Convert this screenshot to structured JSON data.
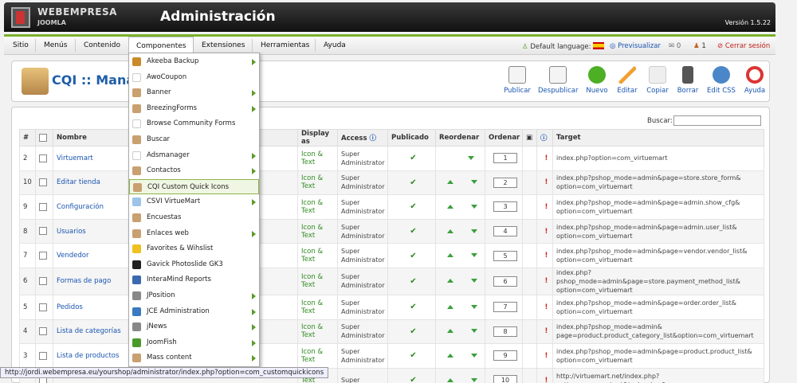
{
  "header": {
    "logo": "WEBEMPRESA",
    "logo_sub": "JOOMLA",
    "title": "Administración",
    "version": "Versión 1.5.22"
  },
  "menu": [
    "Sitio",
    "Menús",
    "Contenido",
    "Componentes",
    "Extensiones",
    "Herramientas",
    "Ayuda"
  ],
  "status": {
    "default_language": "Default language:",
    "preview": "Previsualizar",
    "messages": "0",
    "users": "1",
    "logout": "Cerrar sesión"
  },
  "page_title": "CQI :: Manag",
  "toolbar": [
    "Publicar",
    "Despublicar",
    "Nuevo",
    "Editar",
    "Copiar",
    "Borrar",
    "Edit CSS",
    "Ayuda"
  ],
  "search_label": "Buscar:",
  "columns": [
    "#",
    "",
    "Nombre",
    "Display as",
    "Access",
    "Publicado",
    "Reordenar",
    "Ordenar",
    "",
    "",
    "Target"
  ],
  "rows": [
    {
      "id": "2",
      "name": "Virtuemart",
      "display": "Icon & Text",
      "access": "Super Administrator",
      "order": "1",
      "target": "index.php?option=com_virtuemart"
    },
    {
      "id": "10",
      "name": "Editar tienda",
      "display": "Icon & Text",
      "access": "Super Administrator",
      "order": "2",
      "target": "index.php?pshop_mode=admin&page=store.store_form& option=com_virtuemart"
    },
    {
      "id": "9",
      "name": "Configuración",
      "display": "Icon & Text",
      "access": "Super Administrator",
      "order": "3",
      "target": "index.php?pshop_mode=admin&page=admin.show_cfg& option=com_virtuemart"
    },
    {
      "id": "8",
      "name": "Usuarios",
      "display": "Icon & Text",
      "access": "Super Administrator",
      "order": "4",
      "target": "index.php?pshop_mode=admin&page=admin.user_list& option=com_virtuemart"
    },
    {
      "id": "7",
      "name": "Vendedor",
      "display": "Icon & Text",
      "access": "Super Administrator",
      "order": "5",
      "target": "index.php?pshop_mode=admin&page=vendor.vendor_list& option=com_virtuemart"
    },
    {
      "id": "6",
      "name": "Formas de pago",
      "display": "Icon & Text",
      "access": "Super Administrator",
      "order": "6",
      "target": "index.php?pshop_mode=admin&page=store.payment_method_list& option=com_virtuemart"
    },
    {
      "id": "5",
      "name": "Pedidos",
      "display": "Icon & Text",
      "access": "Super Administrator",
      "order": "7",
      "target": "index.php?pshop_mode=admin&page=order.order_list& option=com_virtuemart"
    },
    {
      "id": "4",
      "name": "Lista de categorías",
      "display": "Icon & Text",
      "access": "Super Administrator",
      "order": "8",
      "target": "index.php?pshop_mode=admin& page=product.product_category_list&option=com_virtuemart"
    },
    {
      "id": "3",
      "name": "Lista de productos",
      "display": "Icon & Text",
      "access": "Super Administrator",
      "order": "9",
      "target": "index.php?pshop_mode=admin&page=product.product_list& option=com_virtuemart"
    },
    {
      "id": "",
      "name": "",
      "display": "Text",
      "access": "Super",
      "order": "10",
      "target": "http://virtuemart.net/index.php?option=com_content&task=view&"
    }
  ],
  "dropdown": [
    {
      "label": "Akeeba Backup",
      "sub": true
    },
    {
      "label": "AwoCoupon",
      "sub": false
    },
    {
      "label": "Banner",
      "sub": true
    },
    {
      "label": "BreezingForms",
      "sub": true
    },
    {
      "label": "Browse Community Forms",
      "sub": false
    },
    {
      "label": "Buscar",
      "sub": false
    },
    {
      "label": "Adsmanager",
      "sub": true
    },
    {
      "label": "Contactos",
      "sub": true
    },
    {
      "label": "CQI Custom Quick Icons",
      "sub": false
    },
    {
      "label": "CSVI VirtueMart",
      "sub": true
    },
    {
      "label": "Encuestas",
      "sub": false
    },
    {
      "label": "Enlaces web",
      "sub": true
    },
    {
      "label": "Favorites & Wihslist",
      "sub": false
    },
    {
      "label": "Gavick Photoslide GK3",
      "sub": false
    },
    {
      "label": "InteraMind Reports",
      "sub": false
    },
    {
      "label": "JPosition",
      "sub": true
    },
    {
      "label": "JCE Administration",
      "sub": true
    },
    {
      "label": "jNews",
      "sub": true
    },
    {
      "label": "JoomFish",
      "sub": true
    },
    {
      "label": "Mass content",
      "sub": true
    }
  ],
  "status_url": "http://jordi.webempresa.eu/yourshop/administrator/index.php?option=com_customquickicons"
}
